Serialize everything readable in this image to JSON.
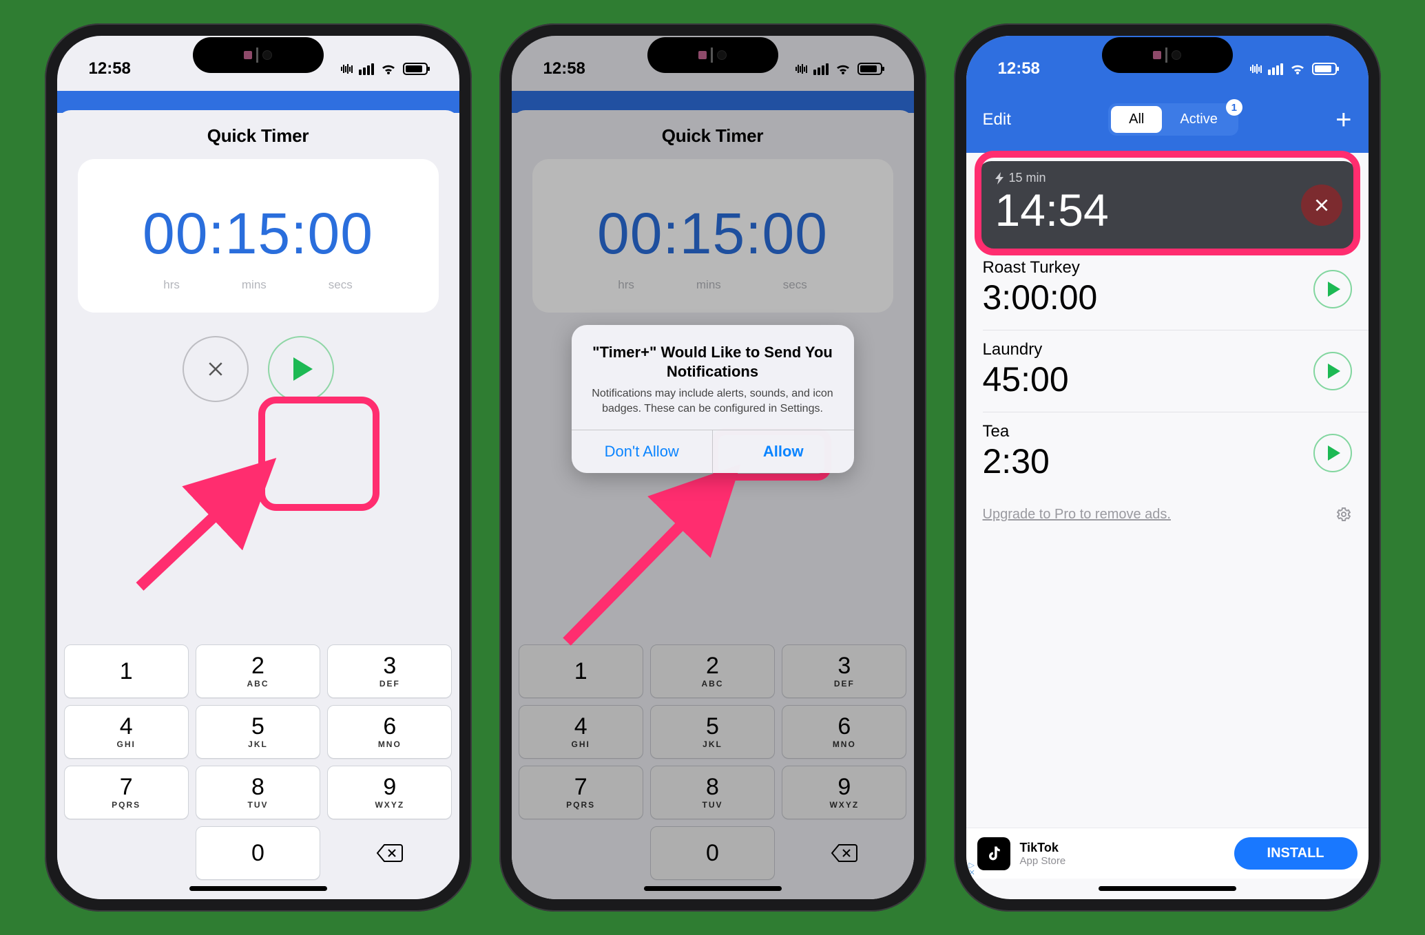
{
  "status": {
    "time": "12:58"
  },
  "keypad": [
    {
      "num": "1",
      "let": ""
    },
    {
      "num": "2",
      "let": "ABC"
    },
    {
      "num": "3",
      "let": "DEF"
    },
    {
      "num": "4",
      "let": "GHI"
    },
    {
      "num": "5",
      "let": "JKL"
    },
    {
      "num": "6",
      "let": "MNO"
    },
    {
      "num": "7",
      "let": "PQRS"
    },
    {
      "num": "8",
      "let": "TUV"
    },
    {
      "num": "9",
      "let": "WXYZ"
    },
    {
      "num": "",
      "let": ""
    },
    {
      "num": "0",
      "let": ""
    }
  ],
  "p1": {
    "title": "Quick Timer",
    "time": "00:15:00",
    "units": {
      "hrs": "hrs",
      "mins": "mins",
      "secs": "secs"
    }
  },
  "p2": {
    "title": "Quick Timer",
    "time": "00:15:00",
    "units": {
      "hrs": "hrs",
      "mins": "mins",
      "secs": "secs"
    },
    "notif": {
      "title": "\"Timer+\" Would Like to Send You Notifications",
      "text": "Notifications may include alerts, sounds, and icon badges. These can be configured in Settings.",
      "deny": "Don't Allow",
      "allow": "Allow"
    }
  },
  "p3": {
    "edit": "Edit",
    "tabs": {
      "all": "All",
      "active": "Active",
      "badge": "1"
    },
    "running": {
      "label": "15 min",
      "time": "14:54"
    },
    "timers": [
      {
        "name": "Roast Turkey",
        "time": "3:00:00"
      },
      {
        "name": "Laundry",
        "time": "45:00"
      },
      {
        "name": "Tea",
        "time": "2:30"
      }
    ],
    "upsell": "Upgrade to Pro to remove ads.",
    "ad": {
      "name": "TikTok",
      "store": "App Store",
      "cta": "INSTALL"
    }
  }
}
